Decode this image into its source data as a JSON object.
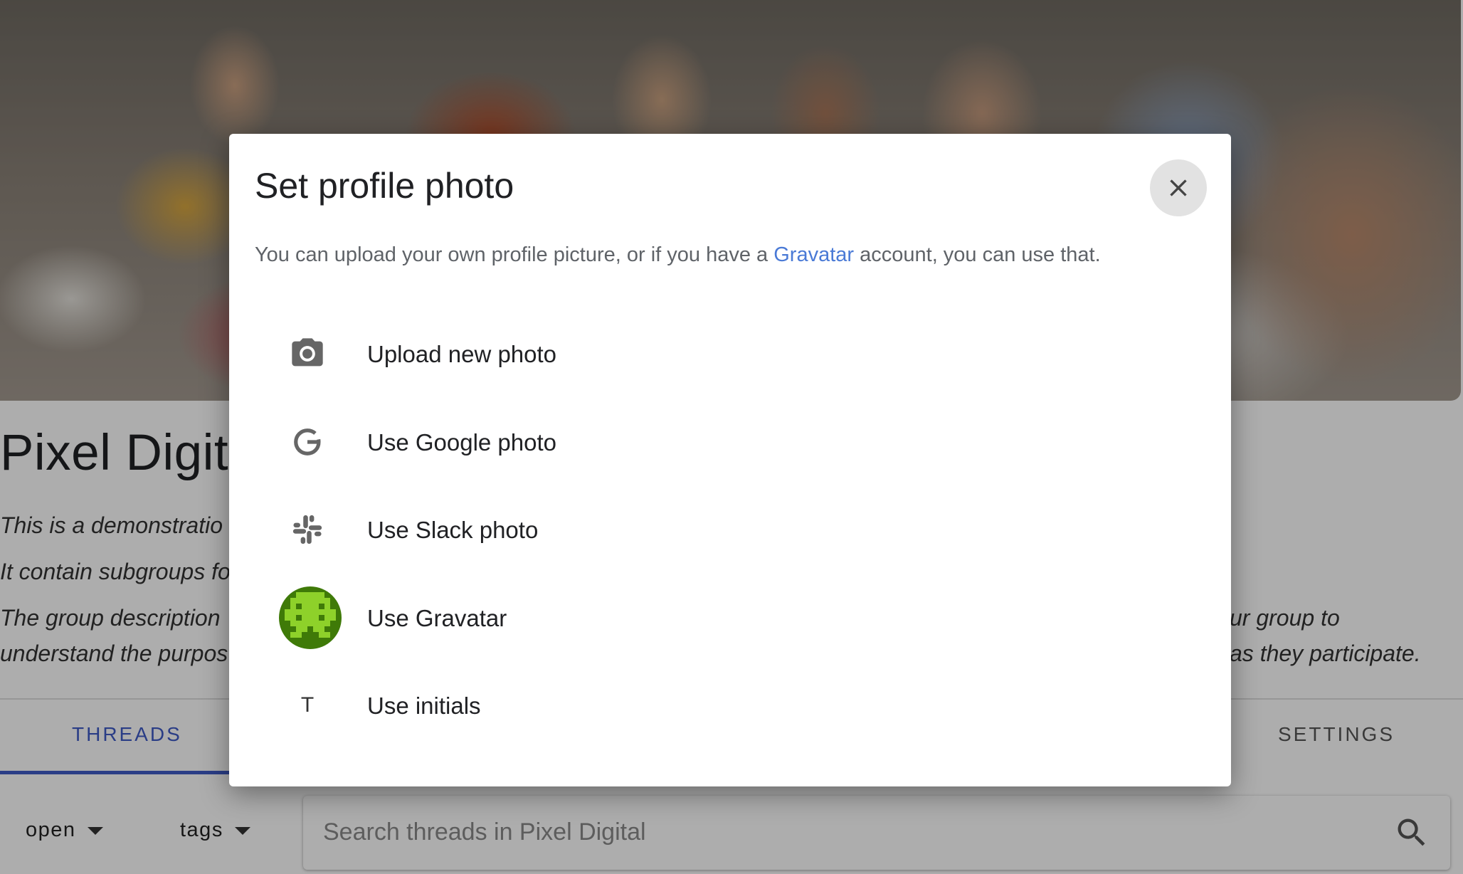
{
  "group": {
    "title": "Pixel Digita",
    "description_lines": [
      "This is a demonstratio",
      "It contain subgroups fo",
      "The group description",
      "understand the purpos"
    ],
    "description_right_lines": [
      "ur group to",
      "as they participate."
    ]
  },
  "tabs": {
    "threads": "THREADS",
    "settings": "SETTINGS"
  },
  "filters": {
    "open": "open",
    "tags": "tags"
  },
  "search": {
    "placeholder": "Search threads in Pixel Digital"
  },
  "modal": {
    "title": "Set profile photo",
    "intro_before": "You can upload your own profile picture, or if you have a ",
    "intro_link": "Gravatar",
    "intro_after": " account, you can use that.",
    "options": [
      {
        "label": "Upload new photo",
        "icon": "camera-icon"
      },
      {
        "label": "Use Google photo",
        "icon": "google-icon"
      },
      {
        "label": "Use Slack photo",
        "icon": "slack-icon"
      },
      {
        "label": "Use Gravatar",
        "icon": "gravatar-avatar"
      },
      {
        "label": "Use initials",
        "icon": "initial-letter",
        "initial": "T"
      }
    ]
  },
  "colors": {
    "accent": "#3f5bc6",
    "link": "#4a7ad6",
    "gravatar_green": "#4a8a0a"
  }
}
